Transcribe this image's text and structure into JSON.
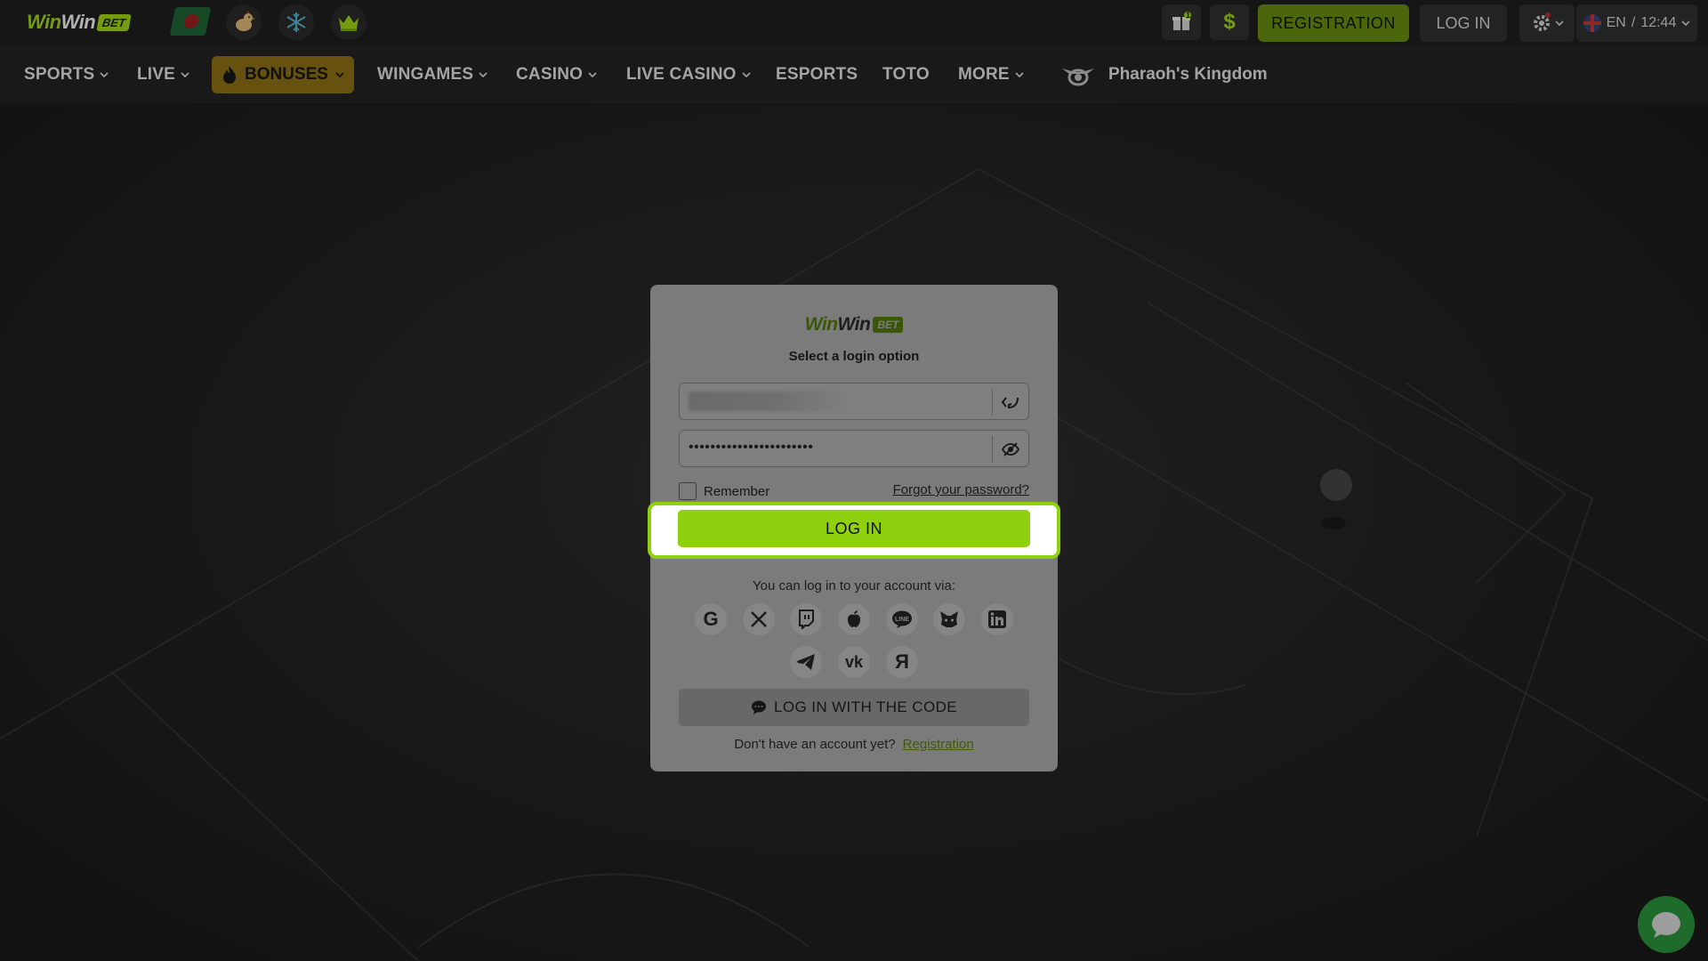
{
  "brand": {
    "word1": "Win",
    "word2": "Win",
    "badge": "BET",
    "accent": "#8fd10e"
  },
  "header": {
    "registration_label": "REGISTRATION",
    "login_label": "LOG IN",
    "language": "EN",
    "time": "12:44",
    "gift_badge": "1",
    "icons": [
      "bangladesh-flag-icon",
      "chicken-icon",
      "snowflake-icon",
      "crown-icon",
      "gift-icon",
      "dollar-icon",
      "gear-icon",
      "uk-flag-icon"
    ]
  },
  "nav": {
    "items": [
      {
        "label": "SPORTS",
        "dropdown": true
      },
      {
        "label": "LIVE",
        "dropdown": true
      },
      {
        "label": "BONUSES",
        "dropdown": true
      },
      {
        "label": "WINGAMES",
        "dropdown": true
      },
      {
        "label": "CASINO",
        "dropdown": true
      },
      {
        "label": "LIVE CASINO",
        "dropdown": true
      },
      {
        "label": "ESPORTS",
        "dropdown": false
      },
      {
        "label": "TOTO",
        "dropdown": false
      },
      {
        "label": "MORE",
        "dropdown": true
      }
    ],
    "promo_label": "Pharaoh's Kingdom"
  },
  "modal": {
    "subtitle": "Select a login option",
    "password_mask": "•••••••••••••••••••••••",
    "remember_label": "Remember",
    "forgot_label": "Forgot your password?",
    "login_button": "LOG IN",
    "via_text": "You can log in to your account via:",
    "social_providers": [
      "google",
      "x",
      "twitch",
      "apple",
      "line",
      "metamask",
      "linkedin",
      "telegram",
      "vk",
      "yandex"
    ],
    "code_button": "LOG IN WITH THE CODE",
    "no_account_text": "Don't have an account yet?",
    "registration_link": "Registration"
  }
}
